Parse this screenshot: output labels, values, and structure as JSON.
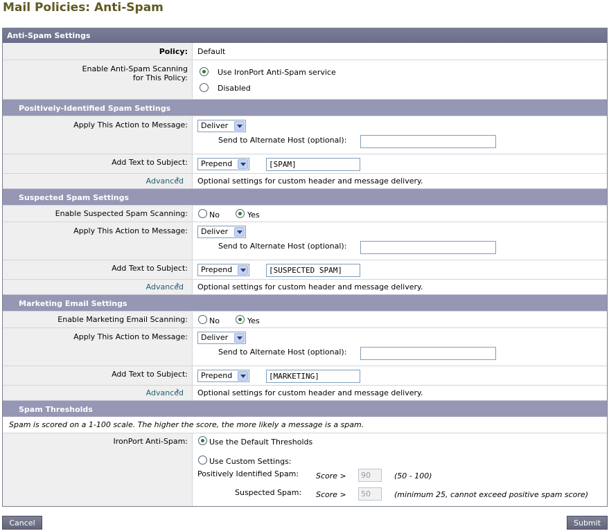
{
  "page": {
    "title": "Mail Policies: Anti-Spam"
  },
  "panel": {
    "title": "Anti-Spam Settings"
  },
  "policy": {
    "label": "Policy:",
    "value": "Default"
  },
  "enable": {
    "label_line1": "Enable Anti-Spam Scanning",
    "label_line2": "for This Policy:",
    "option_ironport": "Use IronPort Anti-Spam service",
    "option_disabled": "Disabled",
    "selected": "ironport"
  },
  "positive": {
    "header": "Positively-Identified Spam Settings",
    "action_label": "Apply This Action to Message:",
    "action_value": "Deliver",
    "alt_host_label": "Send to Alternate Host (optional):",
    "alt_host_value": "",
    "subject_label": "Add Text to Subject:",
    "subject_mode": "Prepend",
    "subject_text": "[SPAM]",
    "advanced_label": "Advanced",
    "advanced_desc": "Optional settings for custom header and message delivery."
  },
  "suspected": {
    "header": "Suspected Spam Settings",
    "enable_label": "Enable Suspected Spam Scanning:",
    "no_label": "No",
    "yes_label": "Yes",
    "enabled": true,
    "action_label": "Apply This Action to Message:",
    "action_value": "Deliver",
    "alt_host_label": "Send to Alternate Host (optional):",
    "alt_host_value": "",
    "subject_label": "Add Text to Subject:",
    "subject_mode": "Prepend",
    "subject_text": "[SUSPECTED SPAM]",
    "advanced_label": "Advanced",
    "advanced_desc": "Optional settings for custom header and message delivery."
  },
  "marketing": {
    "header": "Marketing Email Settings",
    "enable_label": "Enable Marketing Email Scanning:",
    "no_label": "No",
    "yes_label": "Yes",
    "enabled": true,
    "action_label": "Apply This Action to Message:",
    "action_value": "Deliver",
    "alt_host_label": "Send to Alternate Host (optional):",
    "alt_host_value": "",
    "subject_label": "Add Text to Subject:",
    "subject_mode": "Prepend",
    "subject_text": "[MARKETING]",
    "advanced_label": "Advanced",
    "advanced_desc": "Optional settings for custom header and message delivery."
  },
  "thresholds": {
    "header": "Spam Thresholds",
    "note": "Spam is scored on a 1-100 scale. The higher the score, the more likely a message is a spam.",
    "label": "IronPort Anti-Spam:",
    "option_default": "Use the Default Thresholds",
    "option_custom": "Use Custom Settings:",
    "selected": "default",
    "positive_label": "Positively Identified Spam:",
    "score_prefix": "Score >",
    "positive_value": "90",
    "positive_range": "(50 - 100)",
    "suspected_label": "Suspected Spam:",
    "suspected_value": "50",
    "suspected_range": "(minimum 25, cannot exceed positive spam score)"
  },
  "buttons": {
    "cancel": "Cancel",
    "submit": "Submit"
  }
}
